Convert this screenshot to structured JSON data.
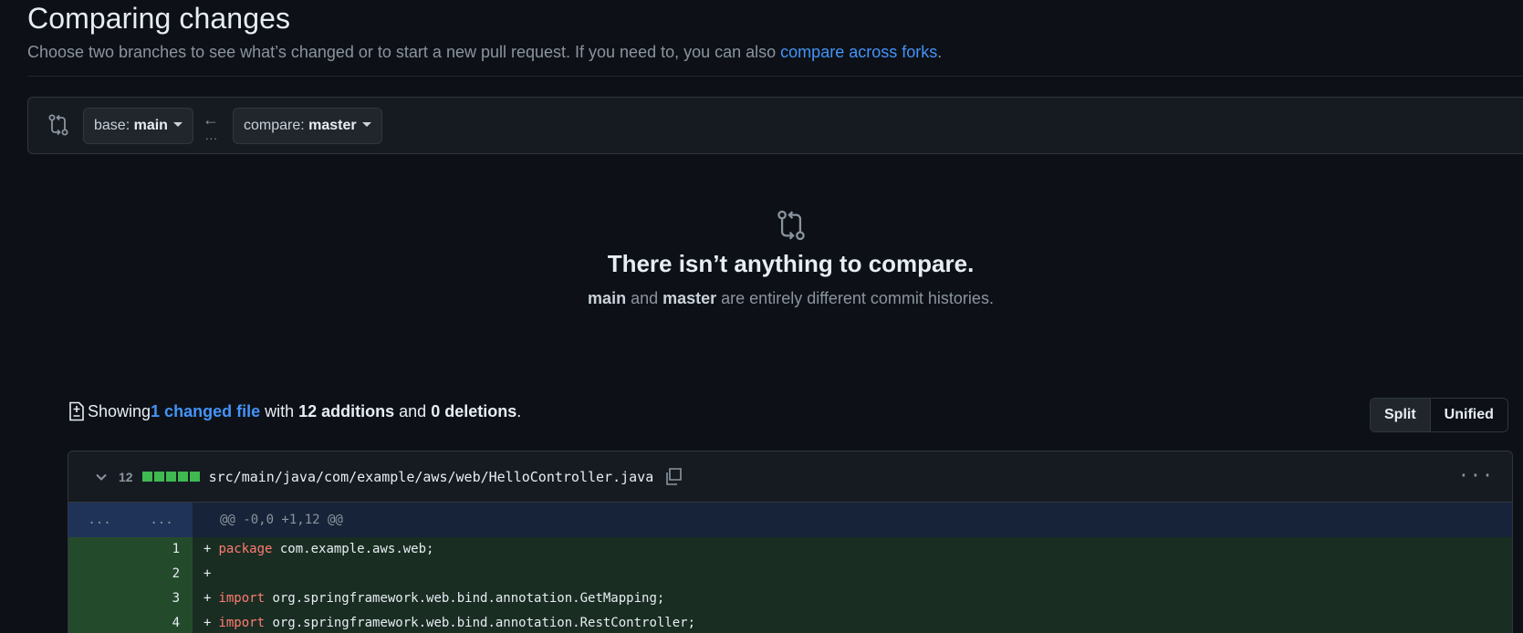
{
  "header": {
    "title": "Comparing changes",
    "subtitle_text": "Choose two branches to see what’s changed or to start a new pull request. If you need to, you can also ",
    "subtitle_link": "compare across forks",
    "subtitle_end": "."
  },
  "range": {
    "base_prefix": "base: ",
    "base_branch": "main",
    "compare_prefix": "compare: ",
    "compare_branch": "master",
    "arrow": "←",
    "dots": "..."
  },
  "blankslate": {
    "title": "There isn’t anything to compare.",
    "sub_branch1": "main",
    "sub_and": " and ",
    "sub_branch2": "master",
    "sub_rest": " are entirely different commit histories."
  },
  "toc": {
    "showing": "Showing ",
    "changed_files": "1 changed file",
    "with": " with ",
    "additions": "12 additions",
    "and": " and ",
    "deletions": "0 deletions",
    "period": "."
  },
  "view": {
    "split": "Split",
    "unified": "Unified"
  },
  "file": {
    "change_count": "12",
    "path": "src/main/java/com/example/aws/web/HelloController.java",
    "menu": "···",
    "hunk": {
      "left": "...",
      "right": "...",
      "text": "@@ -0,0 +1,12 @@"
    },
    "lines": [
      {
        "num": "1",
        "kw": "package",
        "rest": " com.example.aws.web;"
      },
      {
        "num": "2",
        "kw": "",
        "rest": ""
      },
      {
        "num": "3",
        "kw": "import",
        "rest": " org.springframework.web.bind.annotation.GetMapping;"
      },
      {
        "num": "4",
        "kw": "import",
        "rest": " org.springframework.web.bind.annotation.RestController;"
      }
    ]
  },
  "colors": {
    "accent": "#4493f8",
    "addition": "#3fb950",
    "background": "#0d1117"
  }
}
